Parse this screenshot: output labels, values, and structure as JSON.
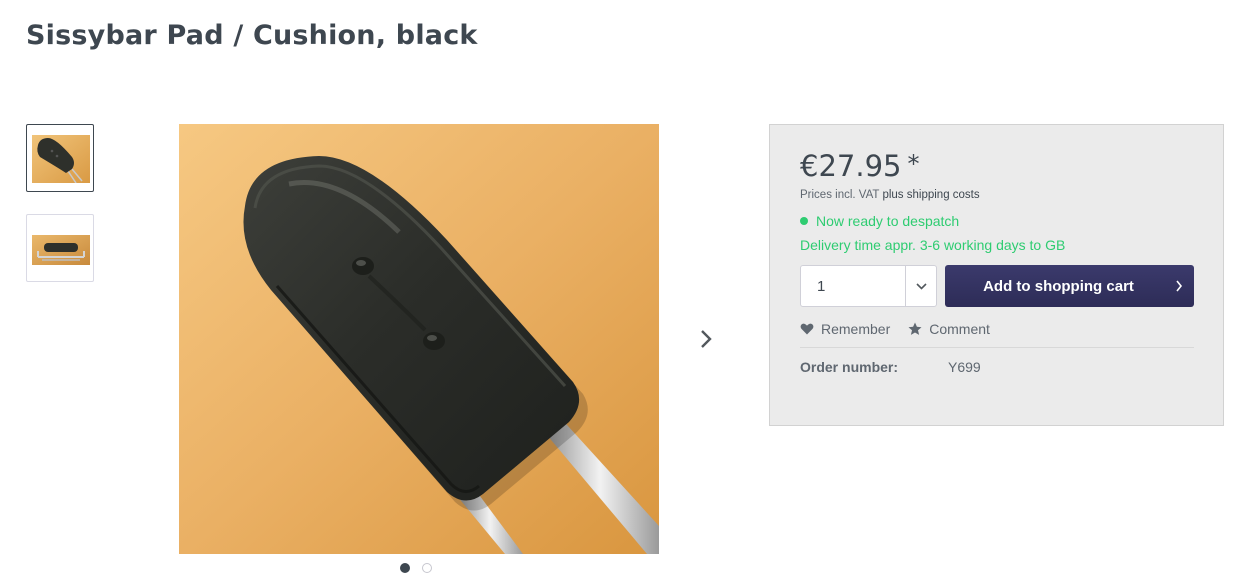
{
  "product": {
    "title": "Sissybar Pad / Cushion, black",
    "price": "€27.95",
    "price_star": "*",
    "vat_text": "Prices incl. VAT",
    "shipping_link": "plus shipping costs",
    "availability": "Now ready to despatch",
    "delivery_time": "Delivery time appr. 3-6 working days to GB",
    "quantity": "1",
    "add_to_cart_label": "Add to shopping cart",
    "remember_label": "Remember",
    "comment_label": "Comment",
    "order_number_label": "Order number:",
    "order_number": "Y699"
  },
  "gallery": {
    "thumbnails": [
      "sissybar-pad-thumb",
      "sissybar-frame-thumb"
    ],
    "active_index": 0,
    "dot_count": 2
  },
  "colors": {
    "title": "#3e4750",
    "accent_button": "#2d2c57",
    "availability_green": "#2ecc71",
    "buybox_bg": "#ebebeb",
    "photo_bg": "#e9b25f"
  },
  "icons": {
    "next": "chevron-right-icon",
    "qty_caret": "chevron-down-icon",
    "cart_chevron": "chevron-right-icon",
    "remember": "heart-icon",
    "comment": "star-icon"
  }
}
